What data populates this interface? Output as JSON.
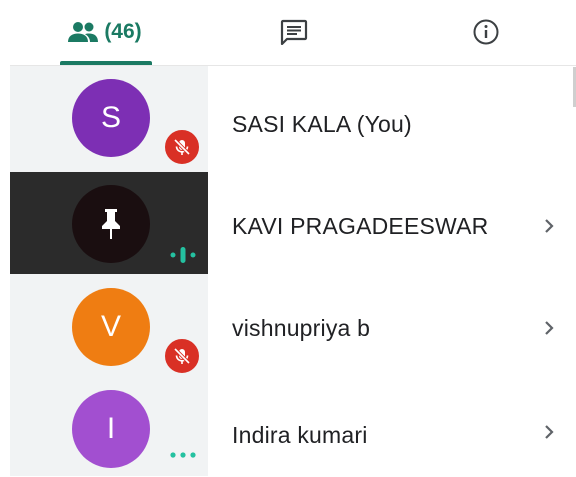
{
  "tabs": {
    "people": {
      "icon": "people-icon",
      "count_label": "(46)"
    },
    "chat": {
      "icon": "chat-icon"
    },
    "info": {
      "icon": "info-icon"
    }
  },
  "participants": [
    {
      "initial": "S",
      "name": "SASI KALA (You)",
      "avatar_color": "#7d2fb4",
      "status_icon": "mic-off-icon"
    },
    {
      "initial": "",
      "name": "KAVI PRAGADEESWAR",
      "avatar_color": "#1a0e10",
      "avatar_icon": "pin-icon",
      "status_icon": "speaking-icon"
    },
    {
      "initial": "V",
      "name": "vishnupriya b",
      "avatar_color": "#ef7d12",
      "status_icon": "mic-off-icon"
    },
    {
      "initial": "I",
      "name": "Indira kumari",
      "avatar_color": "#a24fd0",
      "status_icon": "more-dots-icon"
    }
  ],
  "colors": {
    "accent": "#1b7a63",
    "muted": "#d93025",
    "selected_row": "#2b2b2b",
    "avatar_column": "#f1f3f4"
  }
}
